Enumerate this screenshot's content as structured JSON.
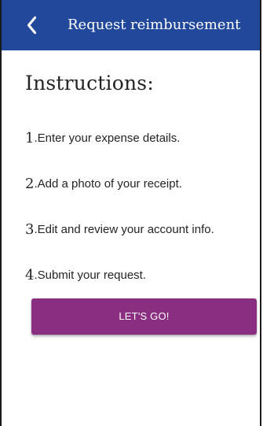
{
  "header": {
    "title": "Request reimbursement",
    "back_icon": "chevron-left-icon"
  },
  "main": {
    "heading": "Instructions:",
    "steps": [
      {
        "number": "1",
        "text": ".Enter your expense details."
      },
      {
        "number": "2",
        "text": ".Add a photo of your receipt."
      },
      {
        "number": "3",
        "text": ".Edit and review your account info."
      },
      {
        "number": "4",
        "text": ".Submit your request."
      }
    ],
    "cta_label": "LET'S GO!"
  },
  "colors": {
    "header_bg": "#21489b",
    "button_bg": "#8a2e81",
    "text": "#242424"
  }
}
